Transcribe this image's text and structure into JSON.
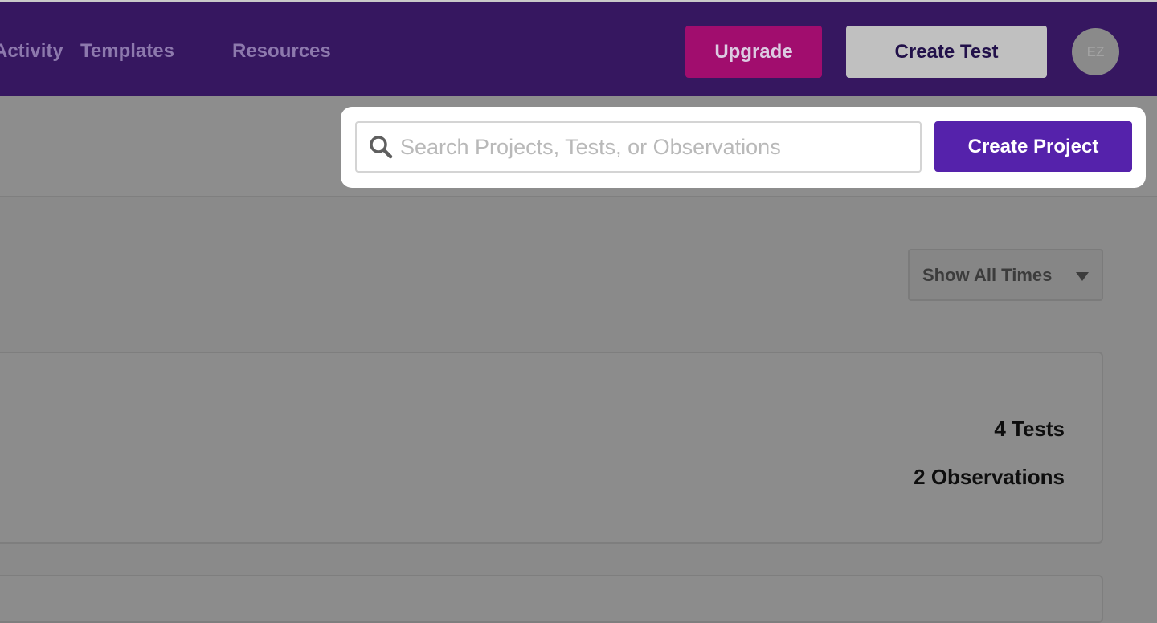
{
  "header": {
    "nav": [
      {
        "label": "Activity"
      },
      {
        "label": "Templates"
      },
      {
        "label": "Resources"
      }
    ],
    "upgrade_label": "Upgrade",
    "create_test_label": "Create Test",
    "avatar_initials": "EZ"
  },
  "toolbar": {
    "search_placeholder": "Search Projects, Tests, or Observations",
    "search_value": "",
    "create_project_label": "Create Project"
  },
  "filter": {
    "selected": "Show All Times"
  },
  "projects": [
    {
      "tests": "4 Tests",
      "observations": "2 Observations"
    }
  ],
  "colors": {
    "header_bg": "#361760",
    "upgrade_bg": "#a10d6e",
    "create_project_bg": "#5522ab",
    "overlay": "#8a8a8a"
  }
}
